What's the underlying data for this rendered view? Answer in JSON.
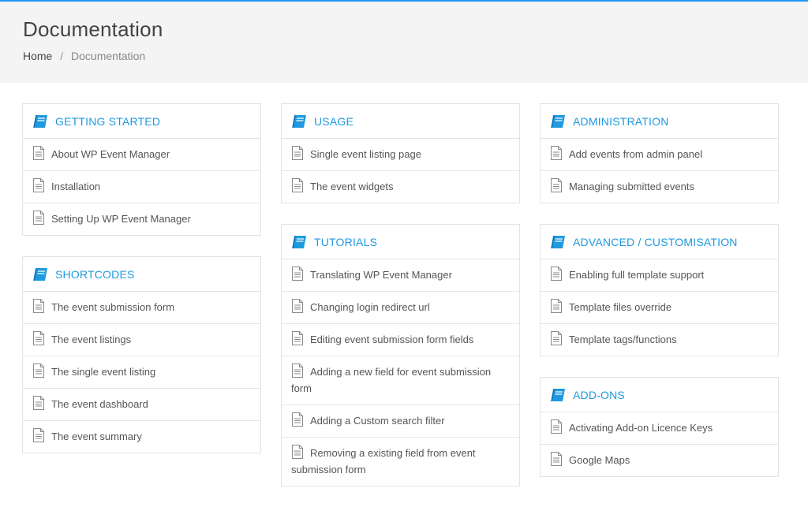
{
  "header": {
    "title": "Documentation",
    "breadcrumb": {
      "home": "Home",
      "separator": "/",
      "current": "Documentation"
    }
  },
  "colors": {
    "accent": "#1e9ae0",
    "header_bg": "#f4f4f4",
    "border": "#e3e3e3"
  },
  "icons": {
    "section": "book-icon",
    "item": "document-icon"
  },
  "columns": [
    [
      {
        "title": "GETTING STARTED",
        "items": [
          "About WP Event Manager",
          "Installation",
          "Setting Up WP Event Manager"
        ]
      },
      {
        "title": "SHORTCODES",
        "items": [
          "The event submission form",
          "The event listings",
          "The single event listing",
          "The event dashboard",
          "The event summary"
        ]
      }
    ],
    [
      {
        "title": "USAGE",
        "items": [
          "Single event listing page",
          "The event widgets"
        ]
      },
      {
        "title": "TUTORIALS",
        "items": [
          "Translating WP Event Manager",
          "Changing login redirect url",
          "Editing event submission form fields",
          "Adding a new field for event submission form",
          "Adding a Custom search filter",
          "Removing a existing field from event submission form"
        ]
      }
    ],
    [
      {
        "title": "ADMINISTRATION",
        "items": [
          "Add events from admin panel",
          "Managing submitted events"
        ]
      },
      {
        "title": "ADVANCED / CUSTOMISATION",
        "items": [
          "Enabling full template support",
          "Template files override",
          "Template tags/functions"
        ]
      },
      {
        "title": "ADD-ONS",
        "items": [
          "Activating Add-on Licence Keys",
          "Google Maps"
        ]
      }
    ]
  ]
}
